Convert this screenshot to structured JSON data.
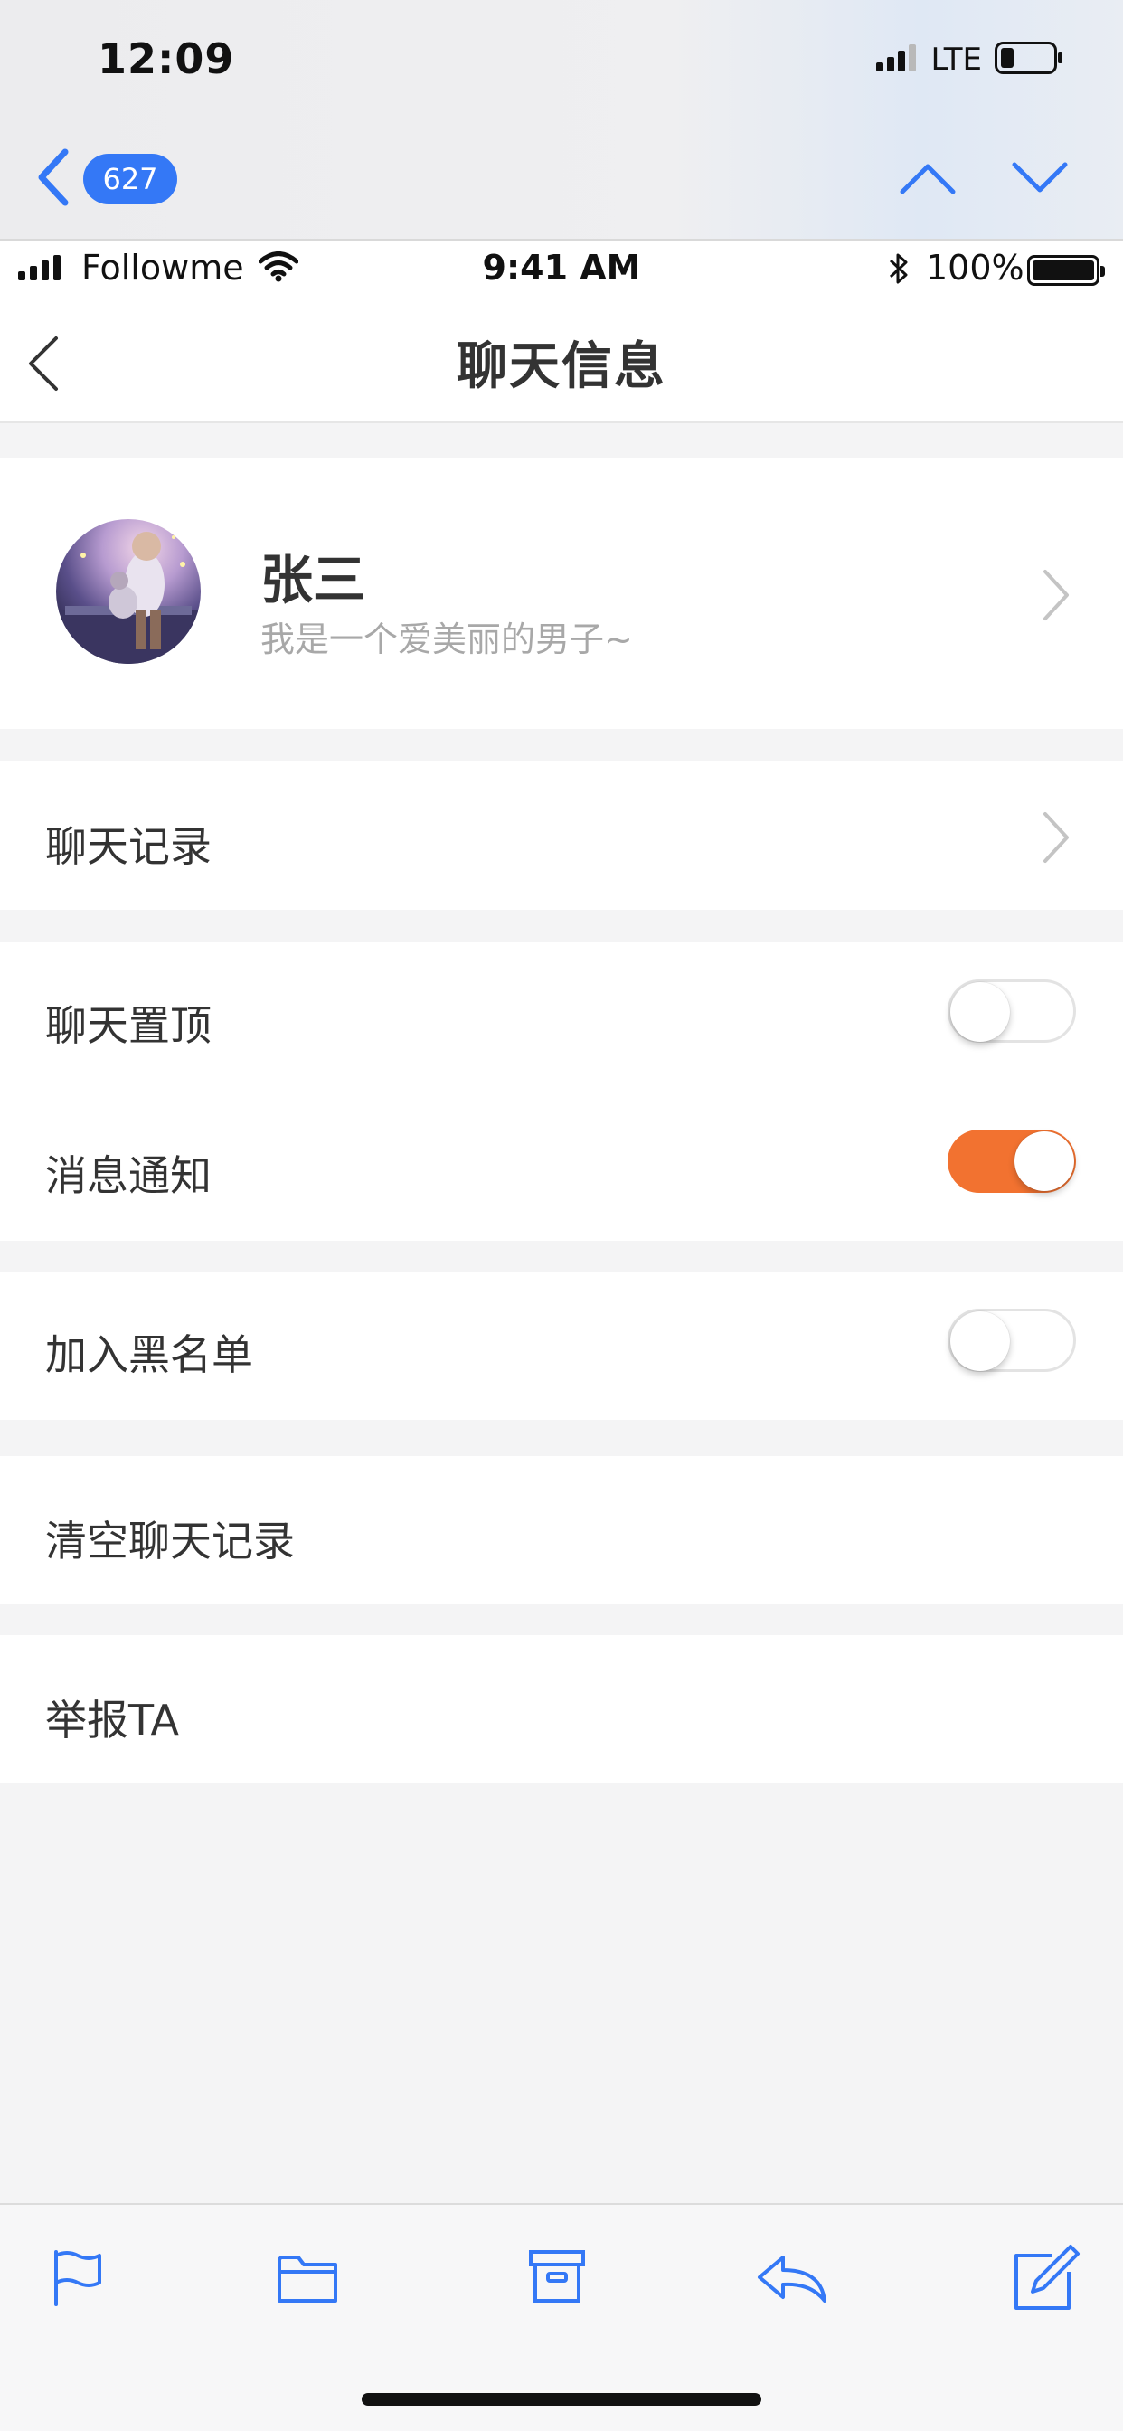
{
  "outer": {
    "time": "12:09",
    "network": "LTE",
    "message_count": "627"
  },
  "inner_status": {
    "carrier": "Followme",
    "time": "9:41 AM",
    "battery": "100%"
  },
  "header": {
    "title": "聊天信息"
  },
  "profile": {
    "name": "张三",
    "signature": "我是一个爱美丽的男子~"
  },
  "rows": {
    "chat_history": "聊天记录",
    "pin_chat": "聊天置顶",
    "notifications": "消息通知",
    "blacklist": "加入黑名单",
    "clear_history": "清空聊天记录",
    "report": "举报TA"
  },
  "toggles": {
    "pin_chat": false,
    "notifications": true,
    "blacklist": false
  },
  "colors": {
    "accent": "#f27230",
    "ios_blue": "#3478f6"
  },
  "toolbar_icons": [
    "flag-icon",
    "folder-icon",
    "archive-icon",
    "reply-icon",
    "compose-icon"
  ]
}
